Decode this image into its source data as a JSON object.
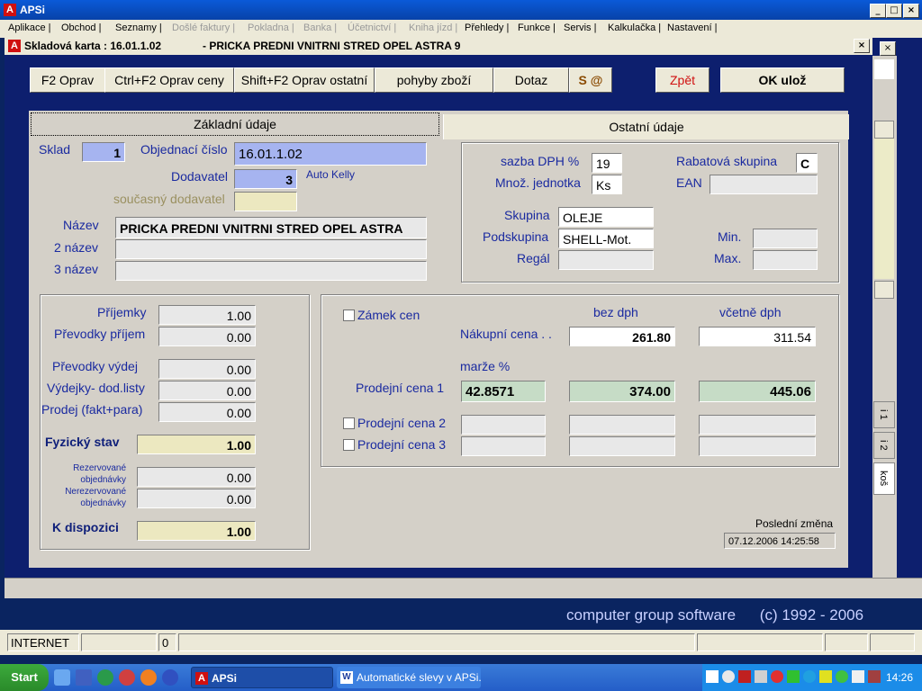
{
  "app": {
    "title": "APSi"
  },
  "menu": [
    {
      "label": "Aplikace |",
      "disabled": false
    },
    {
      "label": "Obchod |",
      "disabled": false
    },
    {
      "label": "Seznamy |",
      "disabled": false
    },
    {
      "label": "Došlé faktury |",
      "disabled": true
    },
    {
      "label": "Pokladna |",
      "disabled": true
    },
    {
      "label": "Banka |",
      "disabled": true
    },
    {
      "label": "Účetnictví |",
      "disabled": true
    },
    {
      "label": "Kniha jízd |",
      "disabled": true
    },
    {
      "label": "Přehledy |",
      "disabled": false
    },
    {
      "label": "Funkce |",
      "disabled": false
    },
    {
      "label": "Servis |",
      "disabled": false
    },
    {
      "label": "Kalkulačka |",
      "disabled": false
    },
    {
      "label": "Nastavení |",
      "disabled": false
    }
  ],
  "dialog": {
    "title": "Skladová karta :   16.01.1.02",
    "subtitle": "- PRICKA PREDNI VNITRNI STRED OPEL ASTRA 9"
  },
  "toolbar": {
    "edit": "F2 Oprav",
    "edit_price": "Ctrl+F2 Oprav ceny",
    "edit_other": "Shift+F2 Oprav ostatní",
    "movements": "pohyby zboží",
    "query": "Dotaz",
    "s_at": "S @",
    "back": "Zpět",
    "ok_save": "OK    ulož"
  },
  "tabs": {
    "basic": "Základní údaje",
    "other": "Ostatní údaje"
  },
  "basic": {
    "sklad_label": "Sklad",
    "sklad": "1",
    "order_no_label": "Objednací číslo",
    "order_no": "16.01.1.02",
    "supplier_label": "Dodavatel",
    "supplier": "3",
    "supplier_name": "Auto Kelly",
    "current_supplier_label": "současný dodavatel",
    "current_supplier": "",
    "name_label": "Název",
    "name": "PRICKA PREDNI VNITRNI STRED OPEL ASTRA",
    "name2_label": "2 název",
    "name2": "",
    "name3_label": "3 název",
    "name3": ""
  },
  "attributes": {
    "vat_label": "sazba DPH %",
    "vat": "19",
    "unit_label": "Množ. jednotka",
    "unit": "Ks",
    "rebate_label": "Rabatová skupina",
    "rebate": "C",
    "ean_label": "EAN",
    "ean": "",
    "group_label": "Skupina",
    "group": "OLEJE",
    "subgroup_label": "Podskupina",
    "subgroup": "SHELL-Mot.",
    "shelf_label": "Regál",
    "shelf": "",
    "min_label": "Min.",
    "min": "",
    "max_label": "Max.",
    "max": ""
  },
  "stock": {
    "receipts_label": "Příjemky",
    "receipts": "1.00",
    "transfer_in_label": "Převodky příjem",
    "transfer_in": "0.00",
    "transfer_out_label": "Převodky  výdej",
    "transfer_out": "0.00",
    "issues_label": "Výdejky- dod.listy",
    "issues": "0.00",
    "sales_label": "Prodej (fakt+para)",
    "sales": "0.00",
    "physical_label": "Fyzický stav",
    "physical": "1.00",
    "reserved_label_1": "Rezervované",
    "reserved_label_2": "objednávky",
    "reserved": "0.00",
    "unreserved_label_1": "Nerezervované",
    "unreserved_label_2": "objednávky",
    "unreserved": "0.00",
    "available_label": "K dispozici",
    "available": "1.00"
  },
  "prices": {
    "lock_label": "Zámek cen",
    "col_net": "bez dph",
    "col_gross": "včetně dph",
    "purchase_label": "Nákupní cena . .",
    "purchase_net": "261.80",
    "purchase_gross": "311.54",
    "margin_label": "marže %",
    "sale1_label": "Prodejní cena 1",
    "sale1_margin": "42.8571",
    "sale1_net": "374.00",
    "sale1_gross": "445.06",
    "sale2_label": "Prodejní cena 2",
    "sale3_label": "Prodejní cena 3"
  },
  "last_change": {
    "label": "Poslední změna",
    "value": "07.12.2006 14:25:58"
  },
  "side_tabs": [
    "i 1",
    "i 2",
    "koš"
  ],
  "brand": {
    "company": "computer group software",
    "copyright": "(c) 1992 - 2006"
  },
  "status": {
    "conn": "INTERNET",
    "num": "0"
  },
  "taskbar": {
    "start": "Start",
    "task1": "APSi",
    "task2": "Automatické slevy v APSi...",
    "clock": "14:26"
  }
}
